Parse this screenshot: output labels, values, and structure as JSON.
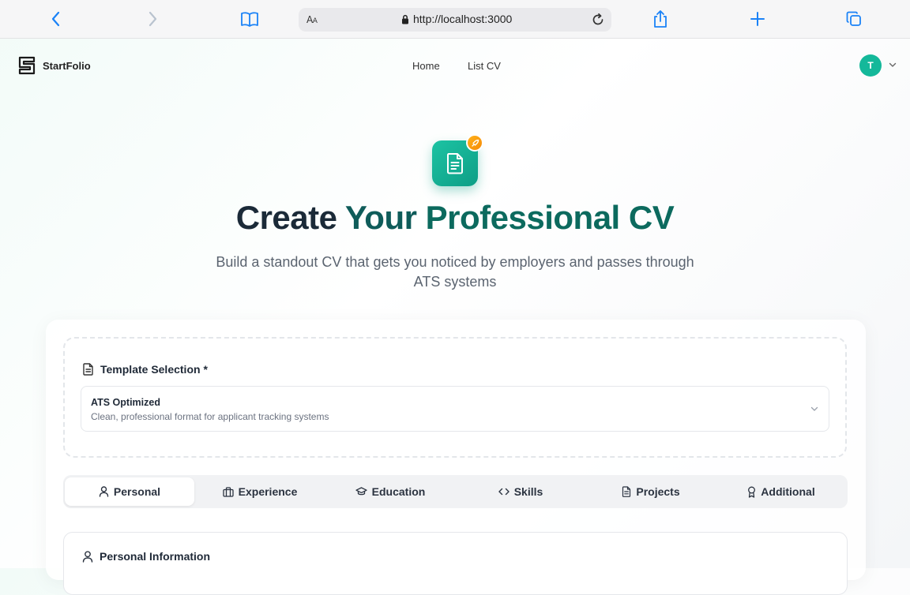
{
  "browser": {
    "aa_label_big": "A",
    "aa_label_small": "A",
    "url": "http://localhost:3000"
  },
  "header": {
    "logo_text": "StartFolio",
    "nav": [
      "Home",
      "List CV"
    ],
    "avatar_initial": "T"
  },
  "hero": {
    "title_part1": "Create ",
    "title_part2": "Your ",
    "title_part3": "Professional CV",
    "subtitle": "Build a standout CV that gets you noticed by employers and passes through ATS systems"
  },
  "template": {
    "label": "Template Selection *",
    "selected_title": "ATS Optimized",
    "selected_description": "Clean, professional format for applicant tracking systems"
  },
  "tabs": [
    {
      "label": "Personal",
      "icon": "user-icon",
      "active": true
    },
    {
      "label": "Experience",
      "icon": "briefcase-icon",
      "active": false
    },
    {
      "label": "Education",
      "icon": "graduation-cap-icon",
      "active": false
    },
    {
      "label": "Skills",
      "icon": "code-icon",
      "active": false
    },
    {
      "label": "Projects",
      "icon": "document-icon",
      "active": false
    },
    {
      "label": "Additional",
      "icon": "award-icon",
      "active": false
    }
  ],
  "section": {
    "title": "Personal Information"
  },
  "colors": {
    "accent": "#14b89a",
    "title_dark": "#1b2a38",
    "title_teal": "#0f5c5a",
    "badge_orange": "#f58a07",
    "safari_blue": "#1a82f7"
  }
}
